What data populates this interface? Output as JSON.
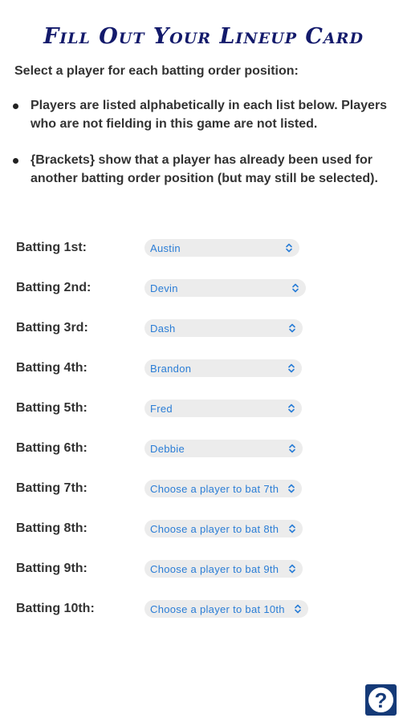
{
  "page": {
    "title": "Fill Out Your Lineup Card",
    "intro": "Select a player for each batting order position:",
    "bullets": [
      "Players are listed alphabetically in each list below. Players who are not fielding in this game are not listed.",
      "{Brackets} show that a player has already been used for another batting order position (but may still be selected)."
    ]
  },
  "lineup": [
    {
      "label": "Batting 1st:",
      "value": "Austin"
    },
    {
      "label": "Batting 2nd:",
      "value": "Devin"
    },
    {
      "label": "Batting 3rd:",
      "value": "Dash"
    },
    {
      "label": "Batting 4th:",
      "value": "Brandon"
    },
    {
      "label": "Batting 5th:",
      "value": "Fred"
    },
    {
      "label": "Batting 6th:",
      "value": "Debbie"
    },
    {
      "label": "Batting 7th:",
      "value": "Choose a player to bat 7th"
    },
    {
      "label": "Batting 8th:",
      "value": "Choose a player to bat 8th"
    },
    {
      "label": "Batting 9th:",
      "value": "Choose a player to bat 9th"
    },
    {
      "label": "Batting 10th:",
      "value": "Choose a player to bat 10th"
    }
  ],
  "help": {
    "icon": "question-icon",
    "glyph": "?"
  },
  "colors": {
    "title": "#131a6b",
    "select_text": "#2a7dd6",
    "select_bg": "#ececec",
    "help_bg": "#153a78"
  }
}
